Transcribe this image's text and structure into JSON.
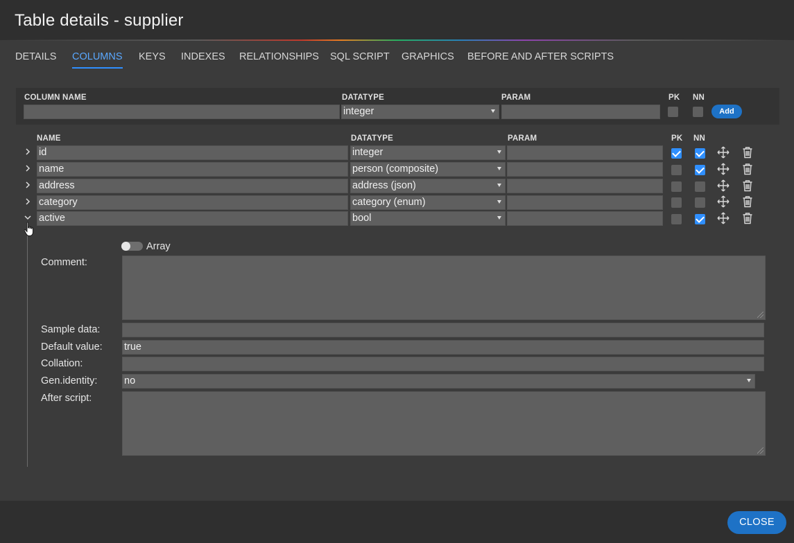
{
  "window": {
    "title": "Table details - supplier"
  },
  "tabs": [
    {
      "label": "DETAILS"
    },
    {
      "label": "COLUMNS",
      "active": true
    },
    {
      "label": "KEYS"
    },
    {
      "label": "INDEXES"
    },
    {
      "label": "RELATIONSHIPS"
    },
    {
      "label": "SQL SCRIPT"
    },
    {
      "label": "GRAPHICS"
    },
    {
      "label": "BEFORE AND AFTER SCRIPTS"
    }
  ],
  "new_column": {
    "headers": {
      "name": "COLUMN NAME",
      "datatype": "DATATYPE",
      "param": "PARAM",
      "pk": "PK",
      "nn": "NN"
    },
    "name_value": "",
    "datatype_value": "integer",
    "param_value": "",
    "pk": false,
    "nn": false,
    "add_label": "Add"
  },
  "columns_list": {
    "headers": {
      "name": "NAME",
      "datatype": "DATATYPE",
      "param": "PARAM",
      "pk": "PK",
      "nn": "NN"
    },
    "rows": [
      {
        "name": "id",
        "datatype": "integer",
        "param": "",
        "pk": true,
        "nn": true,
        "expanded": false
      },
      {
        "name": "name",
        "datatype": "person (composite)",
        "param": "",
        "pk": false,
        "nn": true,
        "expanded": false
      },
      {
        "name": "address",
        "datatype": "address (json)",
        "param": "",
        "pk": false,
        "nn": false,
        "expanded": false
      },
      {
        "name": "category",
        "datatype": "category (enum)",
        "param": "",
        "pk": false,
        "nn": false,
        "expanded": false
      },
      {
        "name": "active",
        "datatype": "bool",
        "param": "",
        "pk": false,
        "nn": true,
        "expanded": true
      }
    ]
  },
  "detail": {
    "array_label": "Array",
    "array_on": false,
    "comment_label": "Comment:",
    "comment_value": "",
    "sample_label": "Sample data:",
    "sample_value": "",
    "default_label": "Default value:",
    "default_value": "true",
    "collation_label": "Collation:",
    "collation_value": "",
    "genidentity_label": "Gen.identity:",
    "genidentity_value": "no",
    "afterscript_label": "After script:",
    "afterscript_value": ""
  },
  "footer": {
    "close_label": "CLOSE"
  },
  "colors": {
    "accent": "#1e72c6",
    "tab_active": "#5aa8ff",
    "checkbox_on": "#2f8fff"
  },
  "icons": [
    "chevron-right-icon",
    "chevron-down-icon",
    "move-icon",
    "trash-icon",
    "hand-cursor-icon"
  ]
}
